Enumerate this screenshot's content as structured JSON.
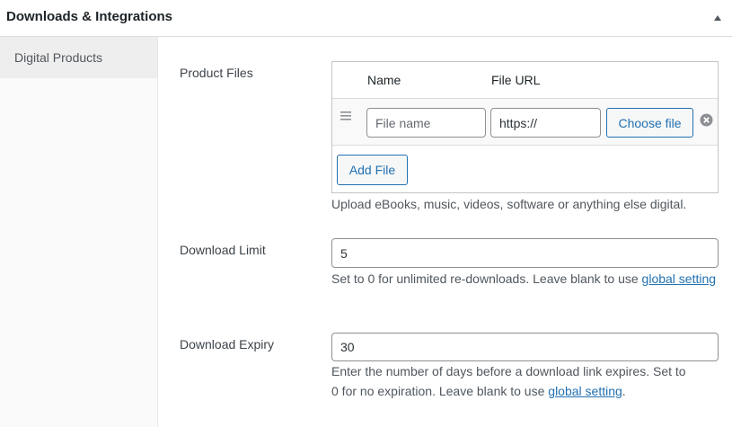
{
  "panel": {
    "title": "Downloads & Integrations",
    "toggle_icon": "triangle-up-icon"
  },
  "sidebar": {
    "tabs": [
      {
        "label": "Digital Products",
        "active": true
      }
    ]
  },
  "product_files": {
    "label": "Product Files",
    "columns": {
      "name": "Name",
      "url": "File URL"
    },
    "rows": [
      {
        "name_value": "",
        "name_placeholder": "File name",
        "url_value": "https://",
        "choose_label": "Choose file"
      }
    ],
    "add_label": "Add File",
    "description": "Upload eBooks, music, videos, software or anything else digital."
  },
  "download_limit": {
    "label": "Download Limit",
    "value": "5",
    "description_text": "Set to 0 for unlimited re-downloads. Leave blank to use ",
    "link_text": "global setting"
  },
  "download_expiry": {
    "label": "Download Expiry",
    "value": "30",
    "description_line1": "Enter the number of days before a download link expires. Set to",
    "description_line2": "0 for no expiration. Leave blank to use ",
    "link_text": "global setting",
    "description_end": "."
  },
  "colors": {
    "accent": "#2271b1",
    "text": "#3c434a",
    "border": "#c3c4c7"
  }
}
